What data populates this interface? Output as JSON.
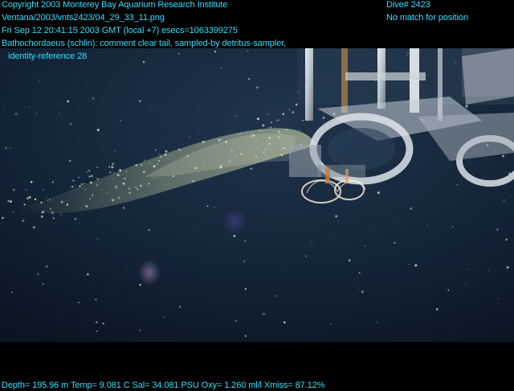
{
  "overlay": {
    "copyright": "Copyright 2003 Monterey Bay Aquarium Research Institute",
    "image_path": "Ventana/2003/vnts2423/04_29_33_11.png",
    "timestamp": "Fri Sep 12 20:41:15 2003 GMT (local +7)  esecs=1063399275",
    "annotation_line1": "Bathochordaeus (schlin): comment clear tail, sampled-by detritus-sampler,",
    "annotation_line2": "identity-reference 28",
    "dive": "Dive# 2423",
    "position_status": "No match for position",
    "sensor_readout": "Depth= 195.96 m  Temp= 9.081 C  Sal= 34.081 PSU  Oxy= 1.260 ml/l  Xmiss= 87.12%"
  },
  "colors": {
    "overlay_text": "#2fe0ff",
    "water_deep": "#0c1826",
    "water_mid": "#1a2c42"
  }
}
